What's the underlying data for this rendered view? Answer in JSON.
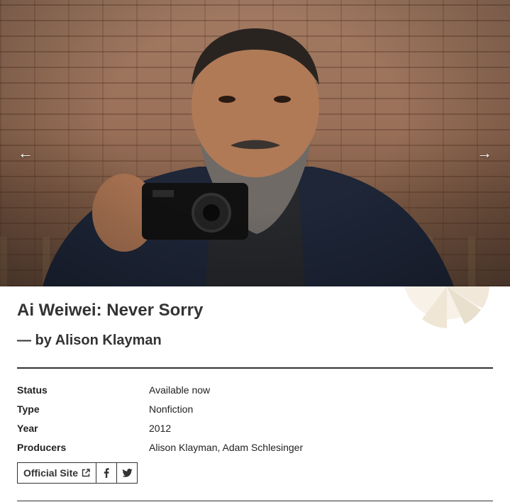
{
  "hero": {
    "prev_arrow": "←",
    "next_arrow": "→"
  },
  "film": {
    "title": "Ai Weiwei: Never Sorry",
    "byline": "— by Alison Klayman"
  },
  "details": [
    {
      "label": "Status",
      "value": "Available now"
    },
    {
      "label": "Type",
      "value": "Nonfiction"
    },
    {
      "label": "Year",
      "value": "2012"
    },
    {
      "label": "Producers",
      "value": "Alison Klayman, Adam Schlesinger"
    }
  ],
  "links": {
    "official_site_label": "Official Site",
    "official_site_icon": "external-link-icon",
    "facebook_icon": "facebook-icon",
    "twitter_icon": "twitter-icon"
  },
  "colors": {
    "text": "#333333",
    "rule": "#333333",
    "decoration": "#f3ece2"
  }
}
